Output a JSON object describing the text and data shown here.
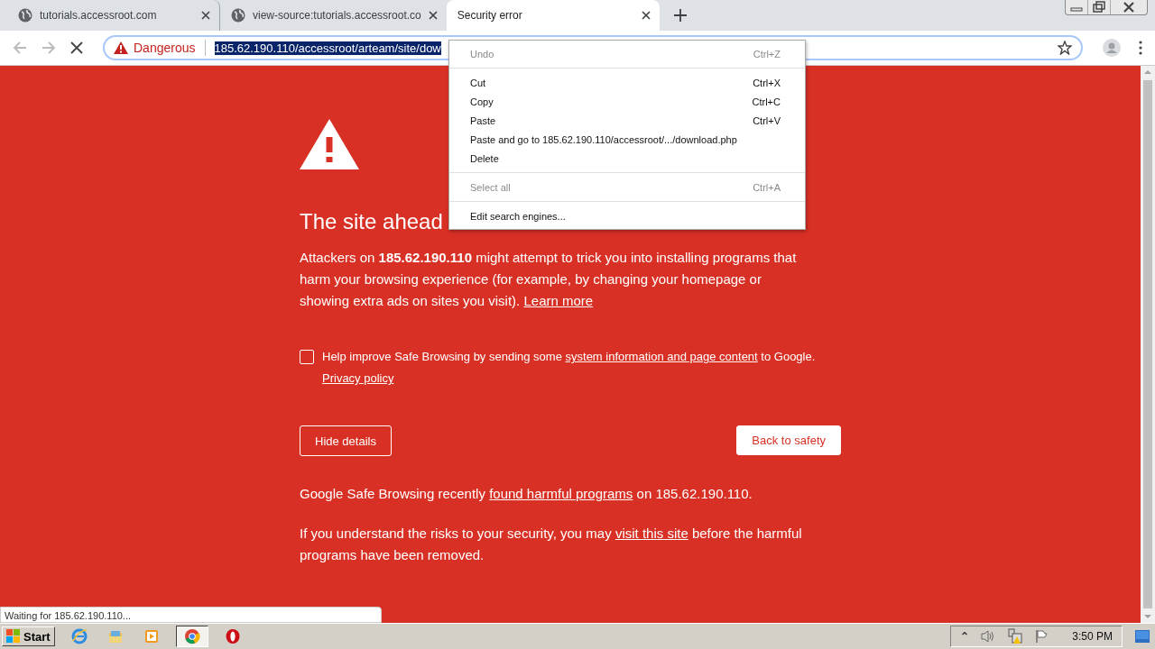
{
  "tabs": [
    {
      "title": "tutorials.accessroot.com",
      "selected": false
    },
    {
      "title": "view-source:tutorials.accessroot.co",
      "selected": false
    },
    {
      "title": "Security error",
      "selected": true
    }
  ],
  "address_bar": {
    "badge": "Dangerous",
    "url": "185.62.190.110/accessroot/arteam/site/dow",
    "selected": true
  },
  "context_menu": [
    {
      "kind": "item",
      "label": "Undo",
      "shortcut": "Ctrl+Z",
      "disabled": true
    },
    {
      "kind": "separator"
    },
    {
      "kind": "item",
      "label": "Cut",
      "shortcut": "Ctrl+X",
      "disabled": false
    },
    {
      "kind": "item",
      "label": "Copy",
      "shortcut": "Ctrl+C",
      "disabled": false
    },
    {
      "kind": "item",
      "label": "Paste",
      "shortcut": "Ctrl+V",
      "disabled": false
    },
    {
      "kind": "item",
      "label": "Paste and go to 185.62.190.110/accessroot/.../download.php",
      "disabled": false
    },
    {
      "kind": "item",
      "label": "Delete",
      "disabled": false
    },
    {
      "kind": "separator"
    },
    {
      "kind": "item",
      "label": "Select all",
      "shortcut": "Ctrl+A",
      "disabled": true
    },
    {
      "kind": "separator"
    },
    {
      "kind": "item",
      "label": "Edit search engines...",
      "disabled": false
    }
  ],
  "page": {
    "heading": "The site ahead",
    "intro": [
      {
        "kind": "text",
        "text": "Attackers on **185.62.190.110** might attempt to trick you into installing programs that harm your browsing experience (for example, by changing your homepage or showing extra ads on sites you visit). "
      },
      {
        "kind": "link",
        "text": "Learn more"
      }
    ],
    "report": {
      "checked": false,
      "parts": [
        {
          "kind": "text",
          "text": "Help improve Safe Browsing by sending some "
        },
        {
          "kind": "link",
          "text": "system information and page content"
        },
        {
          "kind": "text",
          "text": " to Google."
        }
      ],
      "policy_link": "Privacy policy"
    },
    "buttons": [
      {
        "label": "Hide details",
        "kind": "outline"
      },
      {
        "label": "Back to safety",
        "kind": "primary"
      }
    ],
    "details": [
      [
        {
          "kind": "text",
          "text": "Google Safe Browsing recently "
        },
        {
          "kind": "link",
          "text": "found harmful programs"
        },
        {
          "kind": "text",
          "text": " on 185.62.190.110."
        }
      ],
      [
        {
          "kind": "text",
          "text": "If you understand the risks to your security, you may "
        },
        {
          "kind": "link",
          "text": "visit this site"
        },
        {
          "kind": "text",
          "text": " before the harmful programs have been removed."
        }
      ]
    ]
  },
  "status_bubble": "Waiting for 185.62.190.110...",
  "taskbar": {
    "start": "Start",
    "apps": [
      {
        "active": false
      },
      {
        "active": false
      },
      {
        "active": false
      },
      {
        "active": true
      },
      {
        "active": false
      }
    ],
    "tray_up": "⌃",
    "clock": "3:50 PM"
  }
}
